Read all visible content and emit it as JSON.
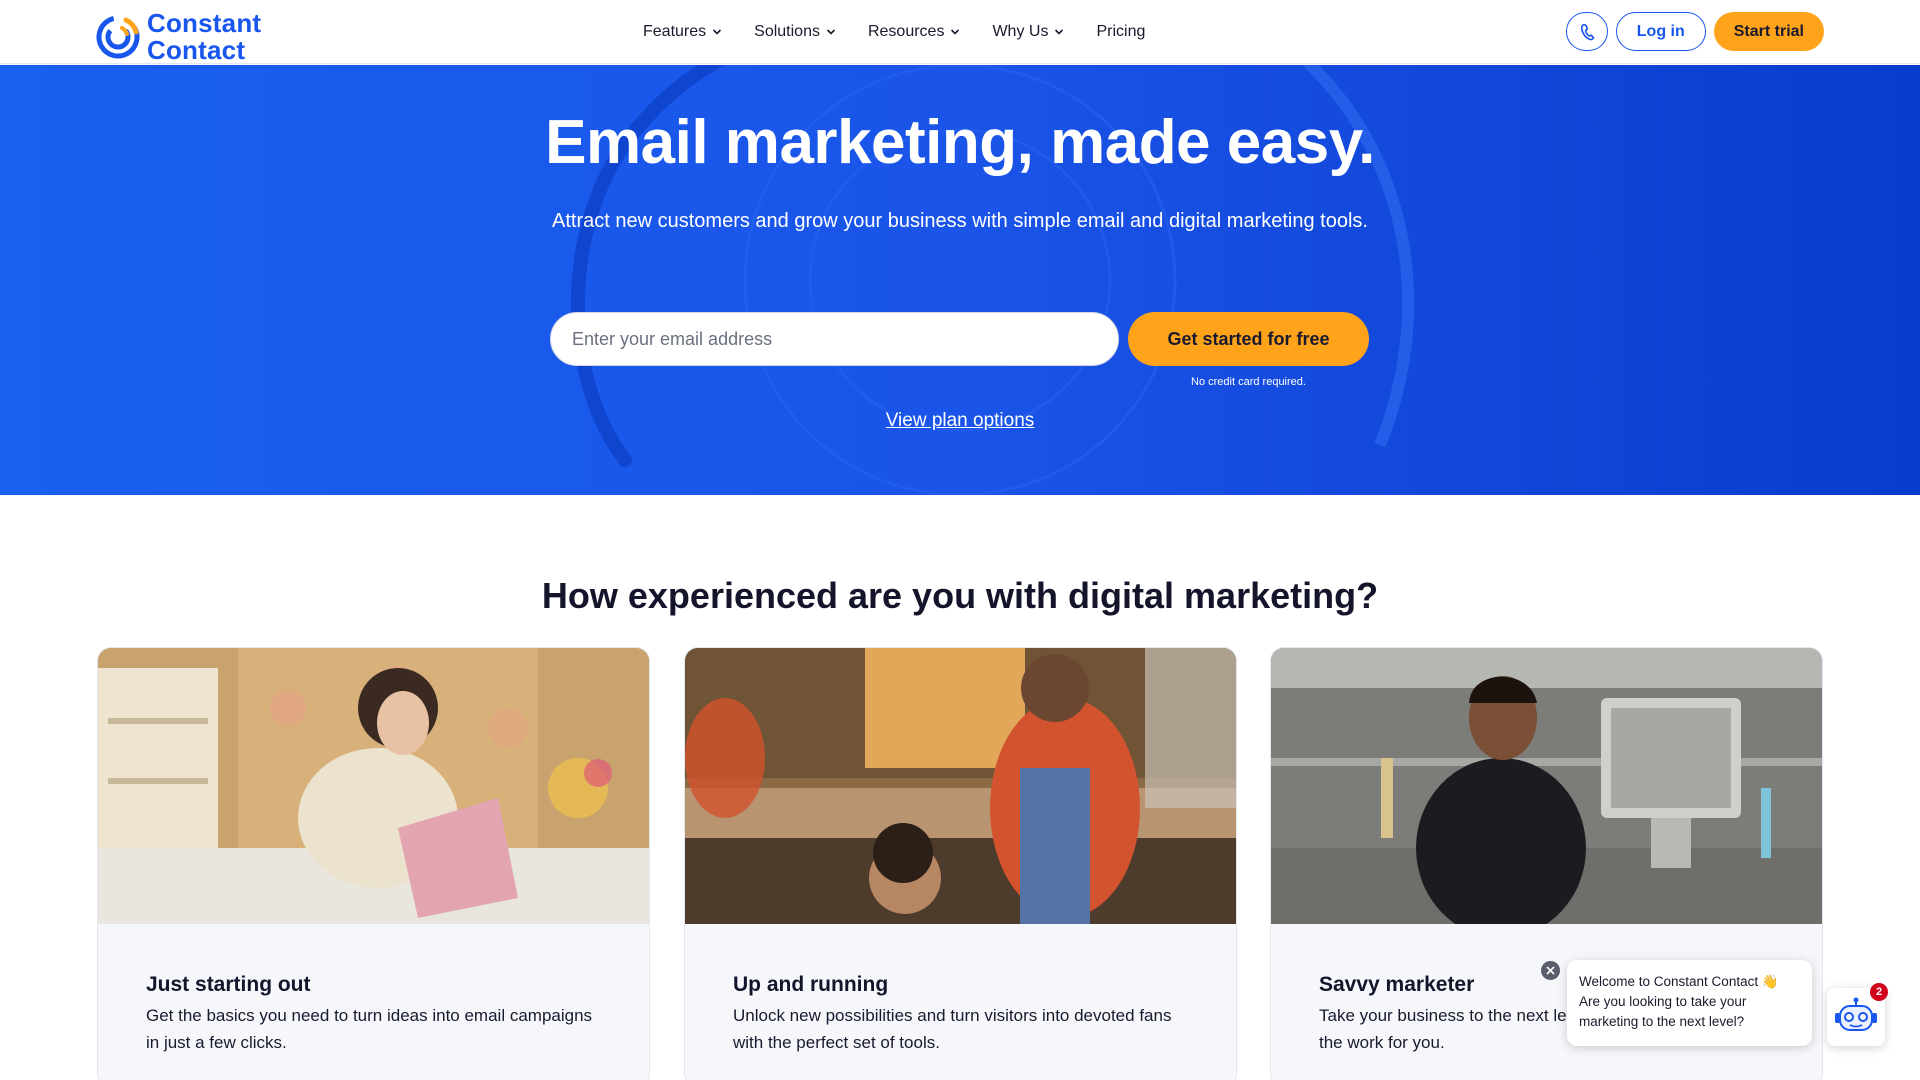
{
  "brand": {
    "line1": "Constant",
    "line2": "Contact",
    "primary_color": "#1856ed",
    "accent_color": "#ffa31a"
  },
  "nav": {
    "items": [
      {
        "label": "Features",
        "dropdown": true
      },
      {
        "label": "Solutions",
        "dropdown": true
      },
      {
        "label": "Resources",
        "dropdown": true
      },
      {
        "label": "Why Us",
        "dropdown": true
      },
      {
        "label": "Pricing",
        "dropdown": false
      }
    ]
  },
  "header_actions": {
    "phone_icon": "phone-icon",
    "login_label": "Log in",
    "trial_label": "Start trial"
  },
  "hero": {
    "title": "Email marketing, made easy.",
    "subtitle": "Attract new customers and grow your business with simple email and digital marketing tools.",
    "email_placeholder": "Enter your email address",
    "email_value": "",
    "cta_label": "Get started for free",
    "no_cc_note": "No credit card required.",
    "plan_link": "View plan options"
  },
  "section": {
    "title": "How experienced are you with digital marketing?",
    "cards": [
      {
        "title": "Just starting out",
        "desc": "Get the basics you need to turn ideas into email campaigns in just a few clicks."
      },
      {
        "title": "Up and running",
        "desc": "Unlock new possibilities and turn visitors into devoted fans with the perfect set of tools."
      },
      {
        "title": "Savvy marketer",
        "desc": "Take your business to the next level with campaigns that do the work for you."
      }
    ]
  },
  "chat": {
    "message_line1": "Welcome to Constant Contact 👋",
    "message_line2": "Are you looking to take your marketing to the next level?",
    "badge_count": "2"
  }
}
